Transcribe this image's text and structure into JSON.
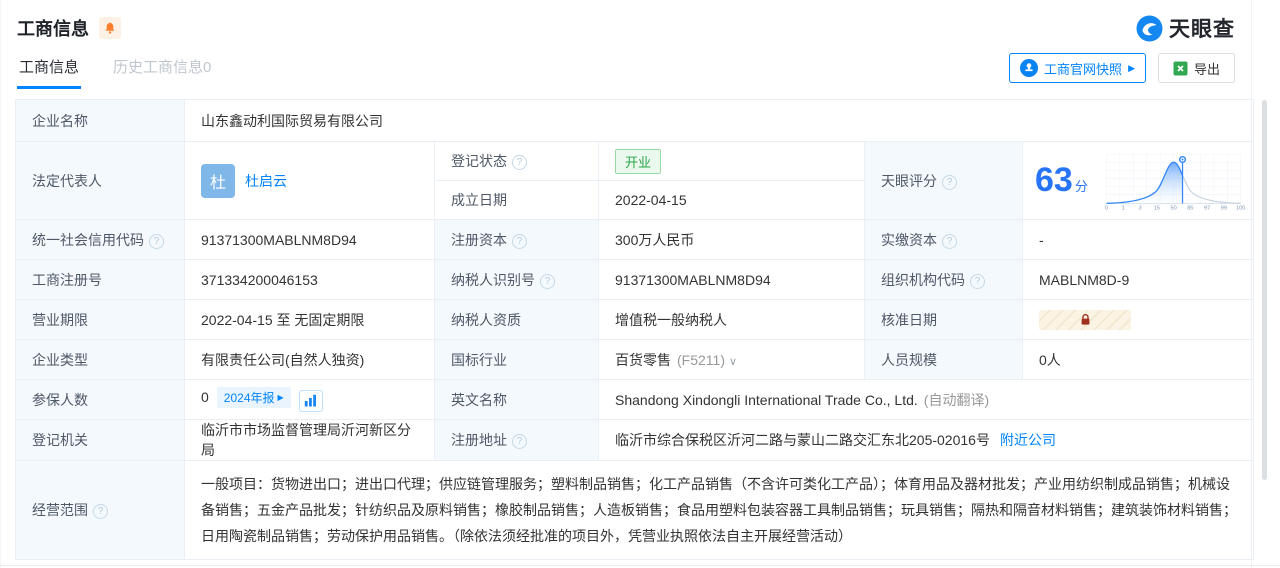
{
  "header": {
    "title": "工商信息"
  },
  "logo": {
    "text": "天眼查"
  },
  "tabs": {
    "current": "工商信息",
    "history": "历史工商信息0"
  },
  "toolbar": {
    "snapshot_label": "工商官网快照",
    "export_label": "导出"
  },
  "icons": {
    "help": "?",
    "play": "▶",
    "chevron_down": "∨"
  },
  "colors": {
    "accent": "#0084ff",
    "status_green": "#28a745",
    "score_blue": "#2775f6",
    "lock_red": "#a2301e",
    "bell_orange": "#ff7e2d",
    "excel_green": "#33a852"
  },
  "fields": {
    "company_name": {
      "label": "企业名称",
      "value": "山东鑫动利国际贸易有限公司"
    },
    "legal_rep": {
      "label": "法定代表人",
      "avatar": "杜",
      "name": "杜启云"
    },
    "reg_status": {
      "label": "登记状态",
      "value": "开业"
    },
    "establish_date": {
      "label": "成立日期",
      "value": "2022-04-15"
    },
    "score": {
      "label": "天眼评分",
      "value": "63",
      "unit": "分",
      "ticks": [
        "0",
        "1",
        "3",
        "15",
        "50",
        "85",
        "97",
        "99",
        "100"
      ]
    },
    "credit_code": {
      "label": "统一社会信用代码",
      "value": "91371300MABLNM8D94"
    },
    "reg_capital": {
      "label": "注册资本",
      "value": "300万人民币"
    },
    "paid_capital": {
      "label": "实缴资本",
      "value": "-"
    },
    "reg_number": {
      "label": "工商注册号",
      "value": "371334200046153"
    },
    "taxpayer_id": {
      "label": "纳税人识别号",
      "value": "91371300MABLNM8D94"
    },
    "org_code": {
      "label": "组织机构代码",
      "value": "MABLNM8D-9"
    },
    "business_term": {
      "label": "营业期限",
      "value": "2022-04-15 至 无固定期限"
    },
    "taxpayer_quality": {
      "label": "纳税人资质",
      "value": "增值税一般纳税人"
    },
    "approval_date": {
      "label": "核准日期"
    },
    "company_type": {
      "label": "企业类型",
      "value": "有限责任公司(自然人独资)"
    },
    "industry": {
      "label": "国标行业",
      "value": "百货零售",
      "code": "(F5211)"
    },
    "staff_size": {
      "label": "人员规模",
      "value": "0人"
    },
    "insured": {
      "label": "参保人数",
      "value": "0",
      "badge": "2024年报"
    },
    "english_name": {
      "label": "英文名称",
      "value": "Shandong Xindongli International Trade Co., Ltd.",
      "note": "(自动翻译)"
    },
    "reg_authority": {
      "label": "登记机关",
      "value": "临沂市市场监督管理局沂河新区分局"
    },
    "reg_address": {
      "label": "注册地址",
      "value": "临沂市综合保税区沂河二路与蒙山二路交汇东北205-02016号",
      "link": "附近公司"
    },
    "business_scope": {
      "label": "经营范围",
      "value": "一般项目：货物进出口；进出口代理；供应链管理服务；塑料制品销售；化工产品销售（不含许可类化工产品）；体育用品及器材批发；产业用纺织制成品销售；机械设备销售；五金产品批发；针纺织品及原料销售；橡胶制品销售；人造板销售；食品用塑料包装容器工具制品销售；玩具销售；隔热和隔音材料销售；建筑装饰材料销售；日用陶瓷制品销售；劳动保护用品销售。（除依法须经批准的项目外，凭营业执照依法自主开展经营活动）"
    }
  }
}
